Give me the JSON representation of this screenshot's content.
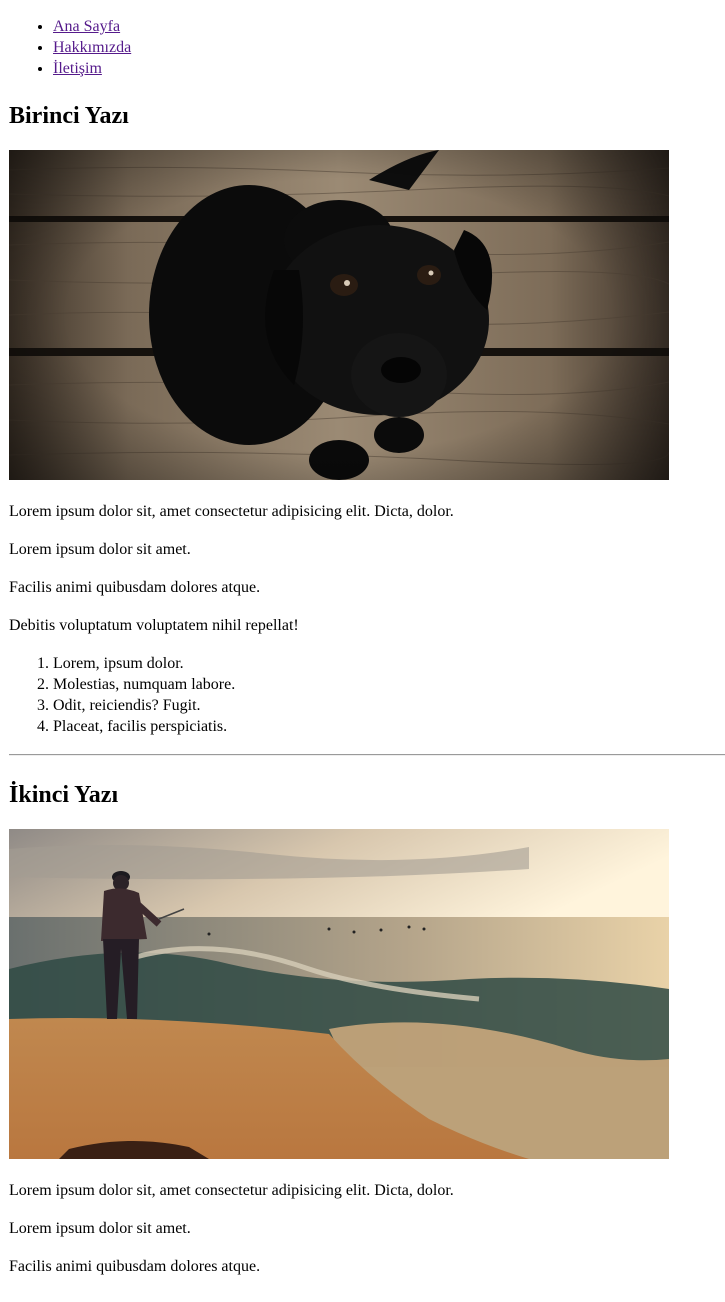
{
  "nav": {
    "items": [
      {
        "label": "Ana Sayfa"
      },
      {
        "label": "Hakkımızda"
      },
      {
        "label": "İletişim"
      }
    ]
  },
  "posts": [
    {
      "title": "Birinci Yazı",
      "image": "black-puppy-on-wooden-floor-photo",
      "paragraphs": [
        "Lorem ipsum dolor sit, amet consectetur adipisicing elit. Dicta, dolor.",
        "Lorem ipsum dolor sit amet.",
        "Facilis animi quibusdam dolores atque.",
        "Debitis voluptatum voluptatem nihil repellat!"
      ],
      "list": [
        "Lorem, ipsum dolor.",
        "Molestias, numquam labore.",
        "Odit, reiciendis? Fugit.",
        "Placeat, facilis perspiciatis."
      ]
    },
    {
      "title": "İkinci Yazı",
      "image": "fisherman-on-shore-at-sunset-photo",
      "paragraphs": [
        "Lorem ipsum dolor sit, amet consectetur adipisicing elit. Dicta, dolor.",
        "Lorem ipsum dolor sit amet.",
        "Facilis animi quibusdam dolores atque."
      ]
    }
  ]
}
